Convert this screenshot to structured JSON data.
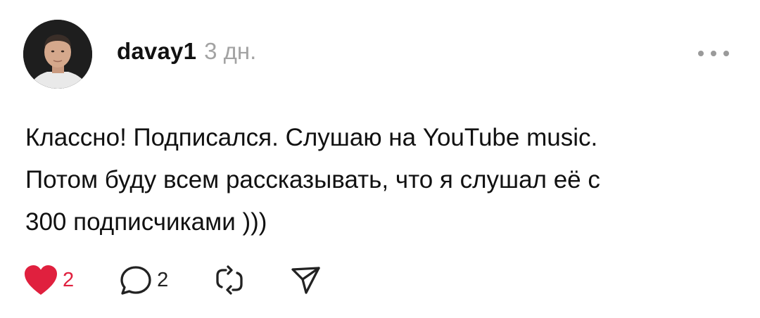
{
  "post": {
    "username": "davay1",
    "time": "3 дн.",
    "text": "Классно! Подписался. Слушаю на YouTube music.\nПотом буду всем рассказывать, что я слушал её с\n300 подписчиками )))",
    "avatar_icon": "avatar-photo",
    "more_icon": "more-dots-icon"
  },
  "actions": {
    "like": {
      "icon": "heart-icon",
      "count": "2",
      "liked": true,
      "color": "#e0203e"
    },
    "reply": {
      "icon": "comment-icon",
      "count": "2"
    },
    "repost": {
      "icon": "repost-icon"
    },
    "share": {
      "icon": "send-icon"
    }
  }
}
